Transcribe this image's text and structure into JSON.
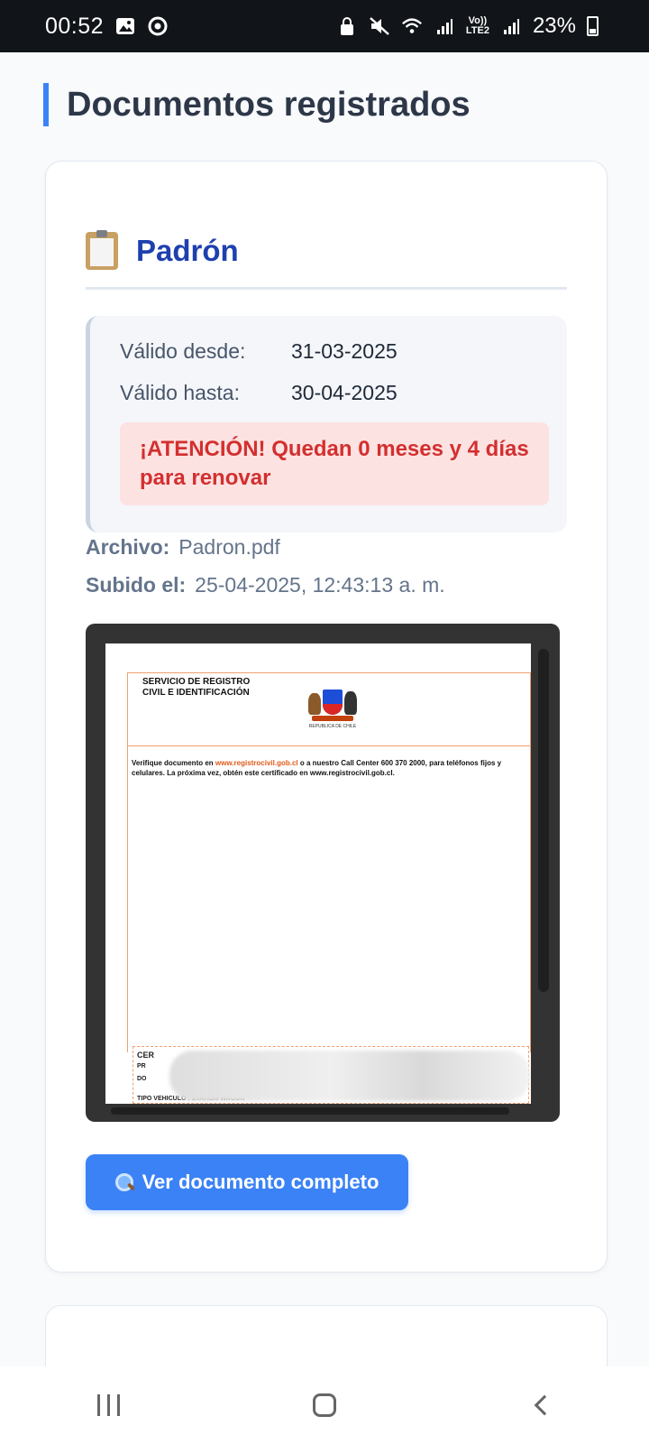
{
  "status_bar": {
    "time": "00:52",
    "lte_top": "Vo))",
    "lte_bottom": "LTE2",
    "battery_pct": "23%"
  },
  "page": {
    "title": "Documentos registrados"
  },
  "document": {
    "title": "Padrón",
    "valid_from_label": "Válido desde:",
    "valid_from": "31-03-2025",
    "valid_to_label": "Válido hasta:",
    "valid_to": "30-04-2025",
    "alert": "¡ATENCIÓN! Quedan 0 meses y 4 días para renovar",
    "file_label": "Archivo:",
    "file_name": "Padron.pdf",
    "uploaded_label": "Subido el:",
    "uploaded_at": "25-04-2025, 12:43:13 a. m.",
    "view_button": "Ver documento completo"
  },
  "preview": {
    "org_line1": "SERVICIO DE REGISTRO",
    "org_line2": "CIVIL E IDENTIFICACIÓN",
    "crest_caption": "REPUBLICA DE CHILE",
    "verify_pre": "Verifique documento en",
    "verify_link": "www.registrocivil.gob.cl",
    "verify_post": "o a nuestro Call Center 600 370 2000, para teléfonos fijos y celulares.  La próxima vez, obtén este certificado en www.registrocivil.gob.cl.",
    "cert_label": "CER",
    "pr_label": "PR",
    "do_label": "DO",
    "tipo_label": "TIPO VEHICULO :  STATION WAGON"
  },
  "colors": {
    "accent": "#3b82f6",
    "title_blue": "#1e40af",
    "alert_bg": "#fde2e2",
    "alert_text": "#d32f2f"
  }
}
